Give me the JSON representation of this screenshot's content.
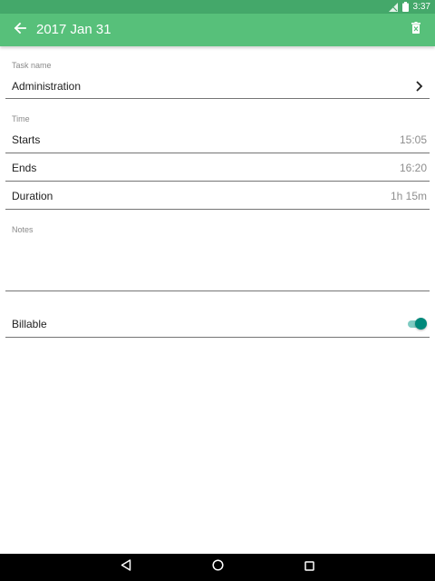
{
  "status_bar": {
    "time": "3:37",
    "icons": [
      "signal-off-icon",
      "battery-icon"
    ]
  },
  "app_bar": {
    "title": "2017 Jan 31",
    "back_icon": "arrow-back-icon",
    "delete_icon": "trash-icon"
  },
  "task": {
    "section_label": "Task name",
    "value": "Administration",
    "chevron_icon": "chevron-right-icon"
  },
  "time": {
    "section_label": "Time",
    "rows": [
      {
        "label": "Starts",
        "value": "15:05"
      },
      {
        "label": "Ends",
        "value": "16:20"
      },
      {
        "label": "Duration",
        "value": "1h 15m"
      }
    ]
  },
  "notes": {
    "section_label": "Notes",
    "value": ""
  },
  "billable": {
    "label": "Billable",
    "enabled": true
  },
  "colors": {
    "status_bar": "#44a86a",
    "app_bar": "#57c07a",
    "toggle_thumb": "#00897b",
    "toggle_track": "#7fcbc2"
  },
  "nav_bar": {
    "buttons": [
      "back-triangle-icon",
      "home-circle-icon",
      "recents-square-icon"
    ]
  }
}
